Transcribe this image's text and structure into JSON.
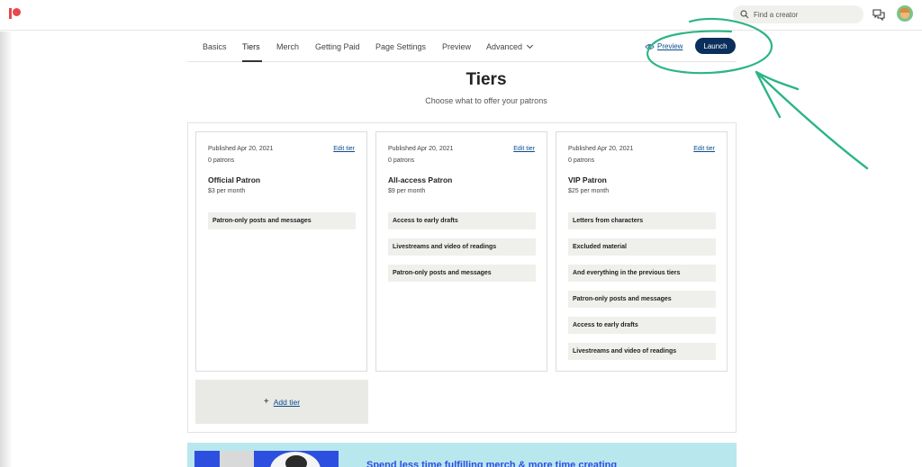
{
  "topbar": {
    "search_placeholder": "Find a creator"
  },
  "nav": {
    "items": [
      {
        "label": "Basics"
      },
      {
        "label": "Tiers"
      },
      {
        "label": "Merch"
      },
      {
        "label": "Getting Paid"
      },
      {
        "label": "Page Settings"
      },
      {
        "label": "Preview"
      },
      {
        "label": "Advanced"
      }
    ],
    "active": "Tiers",
    "preview_link": "Preview",
    "launch_button": "Launch"
  },
  "page": {
    "title": "Tiers",
    "subtitle": "Choose what to offer your patrons"
  },
  "tiers": [
    {
      "published": "Published Apr 20, 2021",
      "edit": "Edit tier",
      "patrons": "0 patrons",
      "name": "Official Patron",
      "price": "$3 per month",
      "benefits": [
        "Patron-only posts and messages"
      ]
    },
    {
      "published": "Published Apr 20, 2021",
      "edit": "Edit tier",
      "patrons": "0 patrons",
      "name": "All-access Patron",
      "price": "$9 per month",
      "benefits": [
        "Access to early drafts",
        "Livestreams and video of readings",
        "Patron-only posts and messages"
      ]
    },
    {
      "published": "Published Apr 20, 2021",
      "edit": "Edit tier",
      "patrons": "0 patrons",
      "name": "VIP Patron",
      "price": "$25 per month",
      "benefits": [
        "Letters from characters",
        "Excluded material",
        "And everything in the previous tiers",
        "Patron-only posts and messages",
        "Access to early drafts",
        "Livestreams and video of readings"
      ]
    }
  ],
  "add_tier": "Add tier",
  "banner": {
    "text": "Spend less time fulfilling merch & more time creating"
  },
  "colors": {
    "brand": "#e8474b",
    "launch": "#0b2f5c",
    "link": "#0c4d8c",
    "annotation": "#2bb584",
    "banner_bg": "#b9e7ee",
    "banner_text": "#2d4fe0"
  }
}
